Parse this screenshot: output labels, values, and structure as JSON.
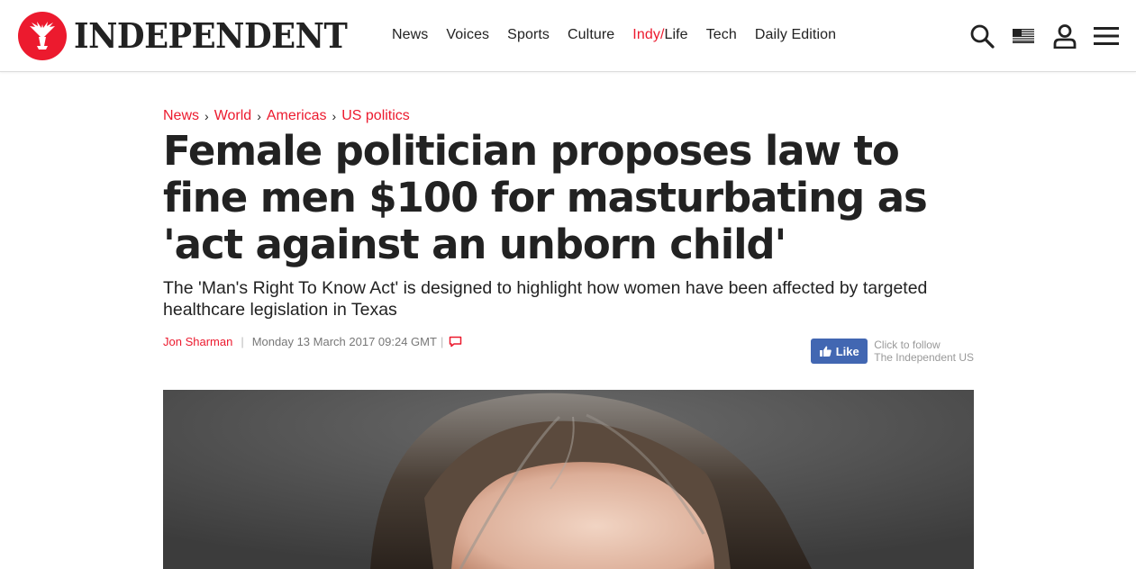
{
  "brand": {
    "name": "INDEPENDENT",
    "accent": "#ec1a2e"
  },
  "nav": {
    "items": [
      "News",
      "Voices",
      "Sports",
      "Culture"
    ],
    "indy_prefix": "Indy/",
    "indy_suffix": "Life",
    "tail": [
      "Tech",
      "Daily Edition"
    ]
  },
  "toolbar": {
    "icons": [
      "search-icon",
      "us-flag-icon",
      "account-icon",
      "menu-icon"
    ]
  },
  "breadcrumb": [
    "News",
    "World",
    "Americas",
    "US politics"
  ],
  "article": {
    "headline": "Female politician proposes law to fine men $100 for masturbating as 'act against an unborn child'",
    "standfirst": "The 'Man's Right To Know Act' is designed to highlight how women have been affected by targeted healthcare legislation in Texas",
    "author": "Jon Sharman",
    "separator": "|",
    "date": "Monday 13 March 2017 09:24 GMT",
    "comment_icon": "comment-icon"
  },
  "follow": {
    "like_label": "Like",
    "line1": "Click to follow",
    "line2": "The Independent US",
    "like_color": "#4267b2"
  }
}
